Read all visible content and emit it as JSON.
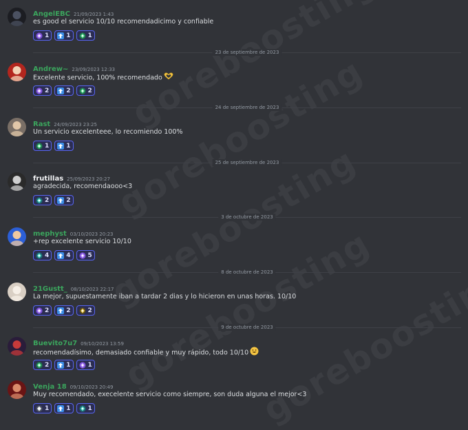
{
  "watermark": "goreboosting",
  "messages": [
    {
      "user": "AngelEBC",
      "user_color": "#3ba55d",
      "time": "21/09/2023 1:43",
      "text": "es good el servicio 10/10 recomendadicimo y confiable",
      "avatar": "dark-avatar-icon",
      "reactions": [
        {
          "icon": "purple-rank-icon",
          "count": "1"
        },
        {
          "icon": "blue-arrow-icon",
          "count": "1"
        },
        {
          "icon": "green-rank-icon",
          "count": "1"
        }
      ]
    },
    {
      "user": "Andrew~",
      "user_color": "#3ba55d",
      "time": "23/09/2023 12:33",
      "text": "Excelente servicio, 100% recomendado",
      "avatar": "santa-avatar-icon",
      "inline_emoji": "heart-hands-emoji-icon",
      "reactions": [
        {
          "icon": "purple-rank-icon",
          "count": "2"
        },
        {
          "icon": "blue-arrow-icon",
          "count": "2"
        },
        {
          "icon": "green-rank-icon",
          "count": "2"
        }
      ]
    },
    {
      "user": "Rast",
      "user_color": "#3ba55d",
      "time": "24/09/2023 23:25",
      "text": "Un servicio excelenteee, lo recomiendo 100%",
      "avatar": "face-avatar-icon",
      "reactions": [
        {
          "icon": "green-rank-icon",
          "count": "1"
        },
        {
          "icon": "blue-arrow-icon",
          "count": "1"
        }
      ]
    },
    {
      "user": "frutillas",
      "user_color": "#f2f3f5",
      "time": "25/09/2023 20:27",
      "text": "agradecida, recomendaooo<3",
      "avatar": "bw-avatar-icon",
      "reactions": [
        {
          "icon": "teal-rank-icon",
          "count": "2"
        },
        {
          "icon": "blue-arrow-icon",
          "count": "2"
        }
      ]
    },
    {
      "user": "mephyst",
      "user_color": "#3ba55d",
      "time": "03/10/2023 20:23",
      "text": "+rep excelente servicio 10/10",
      "avatar": "sonic-avatar-icon",
      "reactions": [
        {
          "icon": "teal-rank-icon",
          "count": "4"
        },
        {
          "icon": "blue-arrow-icon",
          "count": "4"
        },
        {
          "icon": "purple-rank-icon",
          "count": "5"
        }
      ]
    },
    {
      "user": "21Gustt_",
      "user_color": "#3ba55d",
      "time": "08/10/2023 22:17",
      "text": "La mejor, supuestamente iban a tardar 2 dias y lo hicieron en unas horas. 10/10",
      "avatar": "dog-avatar-icon",
      "reactions": [
        {
          "icon": "purple-rank-icon",
          "count": "2"
        },
        {
          "icon": "blue-arrow-icon",
          "count": "2"
        },
        {
          "icon": "yellow-rank-icon",
          "count": "2"
        }
      ]
    },
    {
      "user": "Buevito7u7",
      "user_color": "#3ba55d",
      "time": "09/10/2023 13:59",
      "text": "recomendadísimo, demasiado confiable y muy rápido, todo 10/10",
      "avatar": "hero-avatar-icon",
      "inline_emoji": "grin-emoji-icon",
      "reactions": [
        {
          "icon": "green-rank-icon",
          "count": "2"
        },
        {
          "icon": "blue-arrow-icon",
          "count": "1"
        },
        {
          "icon": "purple-rank-icon",
          "count": "1"
        }
      ]
    },
    {
      "user": "Venja 18",
      "user_color": "#3ba55d",
      "time": "09/10/2023 20:49",
      "text": "Muy recomendado, execelente servicio como siempre, son duda alguna el mejor<3",
      "avatar": "red-avatar-icon",
      "reactions": [
        {
          "icon": "white-rank-icon",
          "count": "1"
        },
        {
          "icon": "blue-arrow-icon",
          "count": "1"
        },
        {
          "icon": "teal-rank-icon",
          "count": "1"
        }
      ]
    }
  ],
  "dividers": [
    "23 de septiembre de 2023",
    "24 de septiembre de 2023",
    "25 de septiembre de 2023",
    "3 de octubre de 2023",
    "8 de octubre de 2023",
    "9 de octubre de 2023"
  ]
}
